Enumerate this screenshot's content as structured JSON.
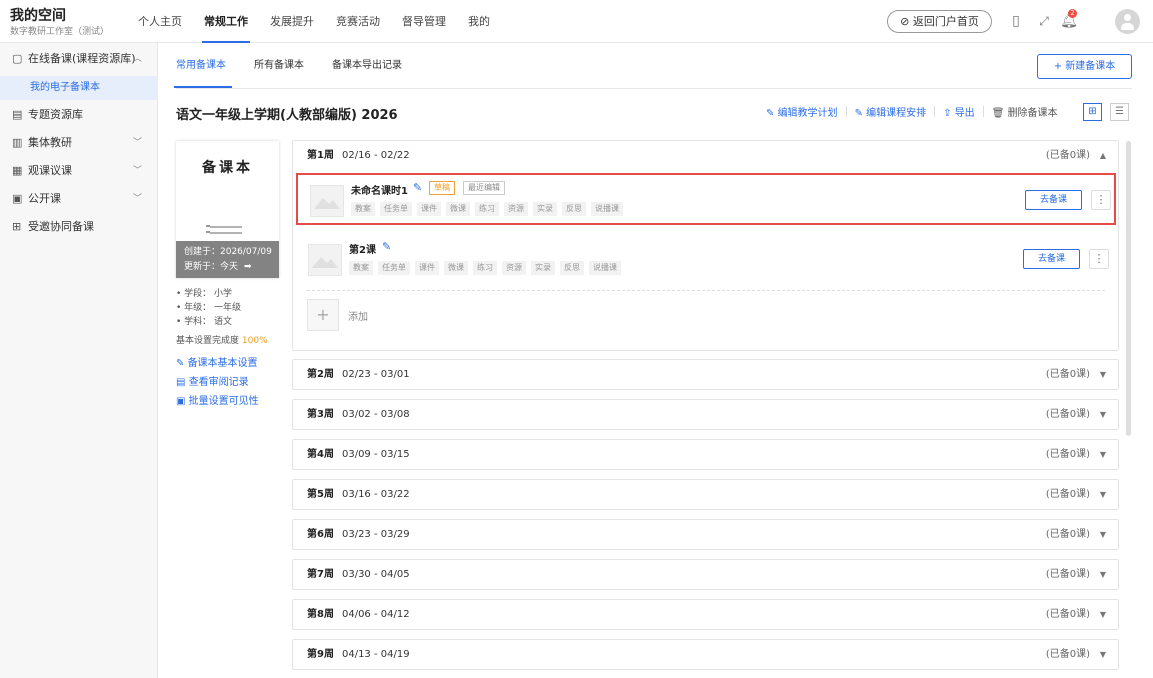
{
  "brand": {
    "title": "我的空间",
    "subtitle": "数字教研工作室（测试）"
  },
  "nav": [
    "个人主页",
    "常规工作",
    "发展提升",
    "竞赛活动",
    "督导管理",
    "我的"
  ],
  "nav_active": "常规工作",
  "header": {
    "return_label": "返回门户首页",
    "notification_count": "2"
  },
  "sidebar": {
    "items": [
      {
        "label": "在线备课(课程资源库)",
        "icon": "file-icon",
        "chevron": "up"
      },
      {
        "label": "我的电子备课本",
        "sub": true
      },
      {
        "label": "专题资源库",
        "icon": "book-icon"
      },
      {
        "label": "集体教研",
        "icon": "columns-icon",
        "chevron": "down"
      },
      {
        "label": "观课议课",
        "icon": "eye-icon",
        "chevron": "down"
      },
      {
        "label": "公开课",
        "icon": "screen-icon",
        "chevron": "down"
      },
      {
        "label": "受邀协同备课",
        "icon": "team-icon"
      }
    ]
  },
  "tabs": [
    "常用备课本",
    "所有备课本",
    "备课本导出记录"
  ],
  "tab_active": "常用备课本",
  "new_button": "+ 新建备课本",
  "book": {
    "title": "语文一年级上学期(人教部编版) 2026",
    "actions": {
      "edit_plan": "编辑教学计划",
      "edit_schedule": "编辑课程安排",
      "export": "导出",
      "delete": "删除备课本"
    },
    "cover_title": "备课本",
    "created": "创建于：2026/07/09",
    "updated": "更新于：今天",
    "stage": "学段：  小学",
    "grade": "年级：  一年级",
    "subject": "学科：  语文",
    "completion_label": "基本设置完成度",
    "completion_value": "100%",
    "links": [
      "备课本基本设置",
      "查看审阅记录",
      "批量设置可见性"
    ]
  },
  "weeks": [
    {
      "label": "第1周",
      "range": "02/16 - 02/22",
      "count": "(已备0课)",
      "expanded": true
    },
    {
      "label": "第2周",
      "range": "02/23 - 03/01",
      "count": "(已备0课)"
    },
    {
      "label": "第3周",
      "range": "03/02 - 03/08",
      "count": "(已备0课)"
    },
    {
      "label": "第4周",
      "range": "03/09 - 03/15",
      "count": "(已备0课)"
    },
    {
      "label": "第5周",
      "range": "03/16 - 03/22",
      "count": "(已备0课)"
    },
    {
      "label": "第6周",
      "range": "03/23 - 03/29",
      "count": "(已备0课)"
    },
    {
      "label": "第7周",
      "range": "03/30 - 04/05",
      "count": "(已备0课)"
    },
    {
      "label": "第8周",
      "range": "04/06 - 04/12",
      "count": "(已备0课)"
    },
    {
      "label": "第9周",
      "range": "04/13 - 04/19",
      "count": "(已备0课)"
    }
  ],
  "lessons": [
    {
      "title": "未命名课时1",
      "draft": "草稿",
      "recent": "最近编辑",
      "go": "去备课",
      "highlighted": true
    },
    {
      "title": "第2课",
      "go": "去备课"
    }
  ],
  "chips": [
    "教案",
    "任务单",
    "课件",
    "微课",
    "练习",
    "资源",
    "实录",
    "反思",
    "说播课"
  ],
  "add_label": "添加",
  "colors": {
    "accent": "#2b6de5",
    "highlight": "#e84b47",
    "draft": "#f39b1e"
  }
}
